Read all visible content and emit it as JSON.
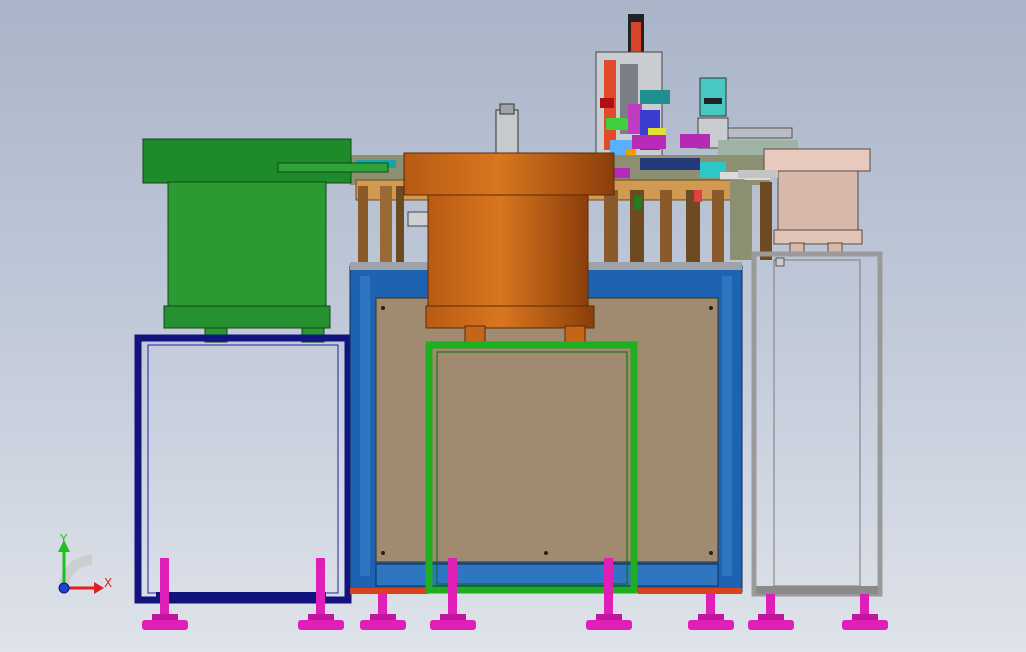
{
  "view": {
    "background_top": "#a9b4c8",
    "background_bottom": "#dfe3ea"
  },
  "colors": {
    "left_feeder": "#1f8a2a",
    "center_feeder": "#c8681c",
    "right_feeder": "#e7cabd",
    "left_frame": "#13137e",
    "center_cabinet": "#1d63b1",
    "center_panel": "#a08a70",
    "green_stand": "#1fae1f",
    "right_frame": "#9a9a9a",
    "feet": "#e01fb8",
    "base_rail": "#d9421d"
  },
  "triad": {
    "y_label": "Y",
    "x_label": "X",
    "y_color": "#1fbf1f",
    "x_color": "#e02020",
    "z_color": "#2040d0"
  }
}
